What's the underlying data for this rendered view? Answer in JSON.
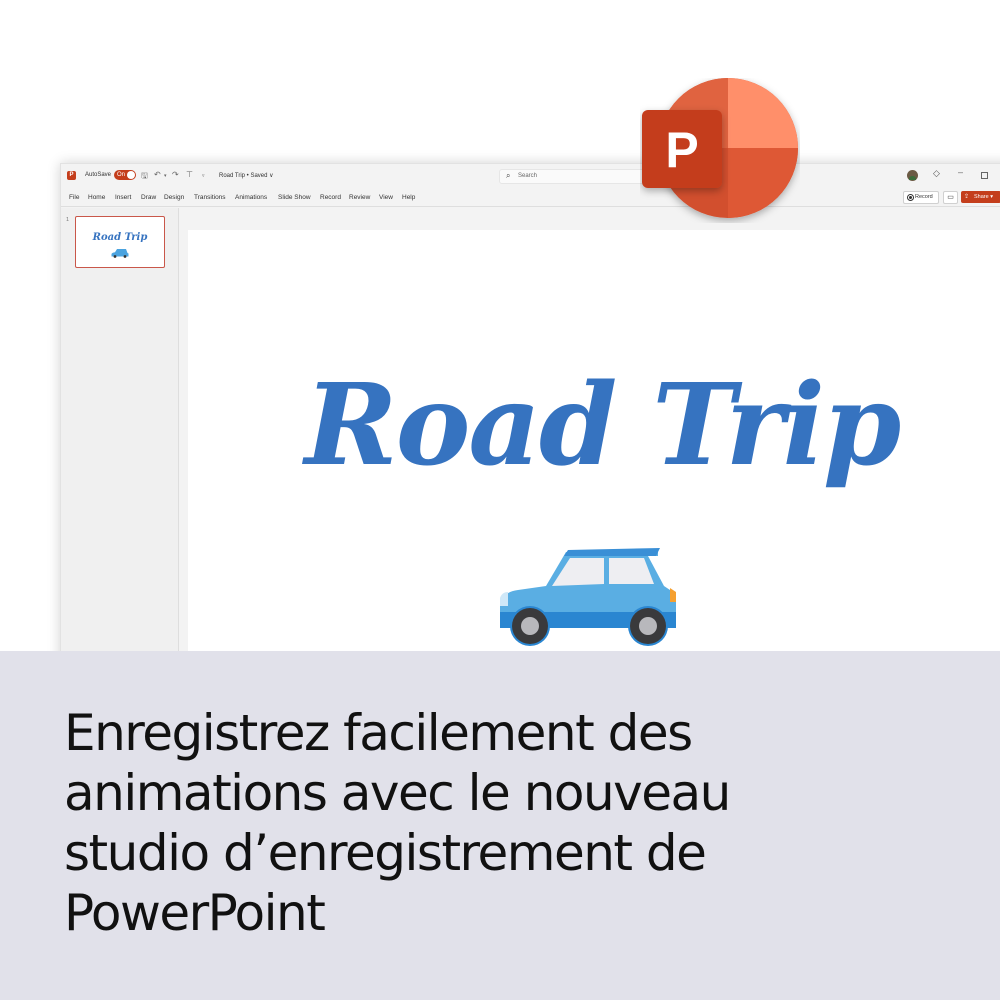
{
  "titlebar": {
    "app_icon_letter": "P",
    "autosave_label": "AutoSave",
    "autosave_state": "On",
    "document_title": "Road Trip • Saved ∨",
    "search_placeholder": "Search",
    "minimize_glyph": "–"
  },
  "menu": {
    "items": [
      "File",
      "Home",
      "Insert",
      "Draw",
      "Design",
      "Transitions",
      "Animations",
      "Slide Show",
      "Record",
      "Review",
      "View",
      "Help"
    ]
  },
  "ribbon_actions": {
    "record_label": "Record",
    "share_label": "Share ▾"
  },
  "thumbnails": [
    {
      "number": "1",
      "title": "Road Trip"
    }
  ],
  "slide": {
    "title": "Road Trip",
    "image": "car-icon"
  },
  "logo": {
    "letter": "P",
    "name": "powerpoint-logo"
  },
  "caption": {
    "text": "Enregistrez facilement des animations avec le nouveau studio d’enregistrement de PowerPoint"
  },
  "colors": {
    "accent": "#c43e1c",
    "title_blue": "#3673c0",
    "caption_bg": "#e1e1ea"
  }
}
